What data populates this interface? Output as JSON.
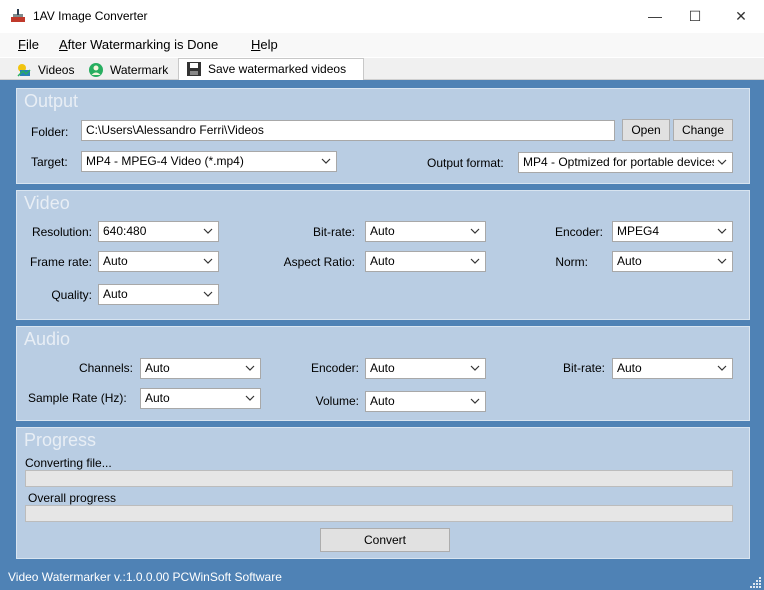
{
  "window": {
    "title": "1AV Image Converter",
    "min_glyph": "—",
    "max_glyph": "☐",
    "close_glyph": "✕"
  },
  "menu": {
    "items": [
      {
        "accel": "F",
        "rest": "ile"
      },
      {
        "accel": "A",
        "rest": "fter Watermarking is Done"
      },
      {
        "accel": "H",
        "rest": "elp"
      }
    ]
  },
  "tabs": [
    {
      "label": "Videos",
      "icon": "videos-icon"
    },
    {
      "label": "Watermark",
      "icon": "watermark-icon"
    },
    {
      "label": "Save watermarked videos",
      "icon": "floppy-disk-icon",
      "active": true
    }
  ],
  "output": {
    "title": "Output",
    "folder_label": "Folder:",
    "folder_value": "C:\\Users\\Alessandro Ferri\\Videos",
    "open_label": "Open",
    "change_label": "Change",
    "target_label": "Target:",
    "target_value": "MP4 - MPEG-4 Video (*.mp4)",
    "format_label": "Output format:",
    "format_value": "MP4 - Optmized for portable devices"
  },
  "video": {
    "title": "Video",
    "resolution_label": "Resolution:",
    "resolution_value": "640:480",
    "bitrate_label": "Bit-rate:",
    "bitrate_value": "Auto",
    "encoder_label": "Encoder:",
    "encoder_value": "MPEG4",
    "framerate_label": "Frame rate:",
    "framerate_value": "Auto",
    "aspect_label": "Aspect Ratio:",
    "aspect_value": "Auto",
    "norm_label": "Norm:",
    "norm_value": "Auto",
    "quality_label": "Quality:",
    "quality_value": "Auto"
  },
  "audio": {
    "title": "Audio",
    "channels_label": "Channels:",
    "channels_value": "Auto",
    "encoder_label": "Encoder:",
    "encoder_value": "Auto",
    "bitrate_label": "Bit-rate:",
    "bitrate_value": "Auto",
    "samplerate_label": "Sample Rate (Hz):",
    "samplerate_value": "Auto",
    "volume_label": "Volume:",
    "volume_value": "Auto"
  },
  "progress": {
    "title": "Progress",
    "converting_label": "Converting file...",
    "converting_fraction": 0,
    "overall_label": "Overall progress",
    "overall_fraction": 0,
    "convert_label": "Convert"
  },
  "status": {
    "text": "Video Watermarker v.:1.0.0.00 PCWinSoft Software"
  },
  "colors": {
    "accent": "#4f82b5",
    "panel": "#b9cde3"
  }
}
